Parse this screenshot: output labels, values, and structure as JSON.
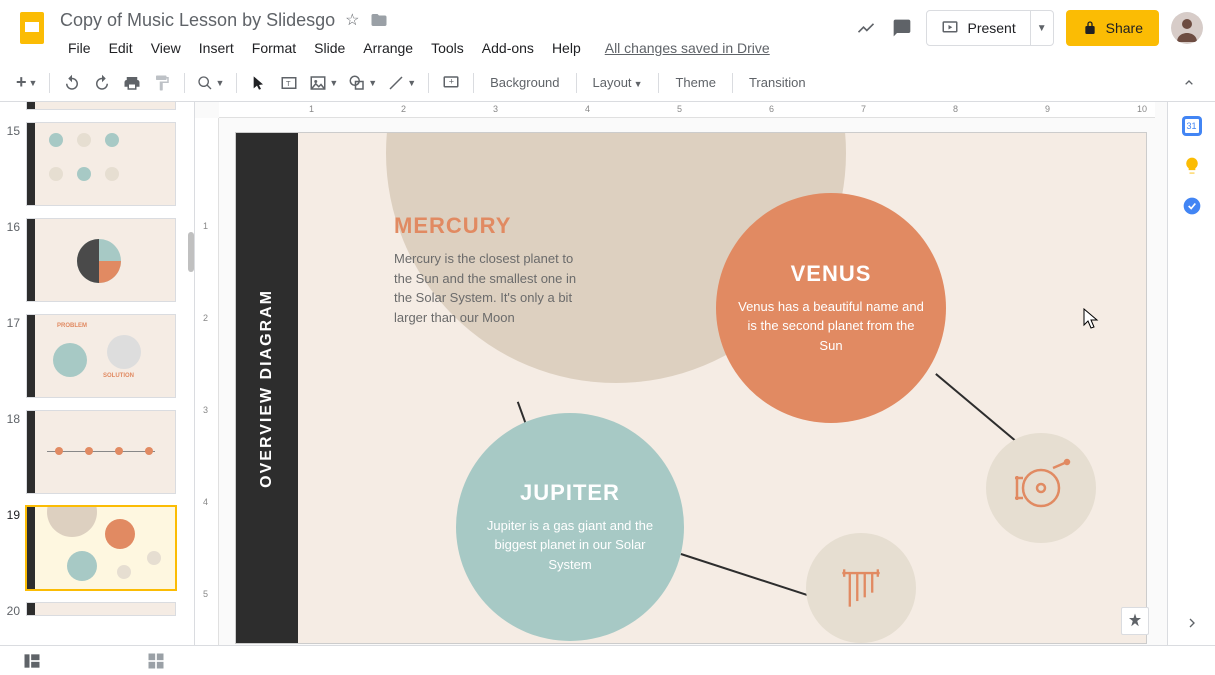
{
  "header": {
    "title": "Copy of Music Lesson by Slidesgo",
    "save_status": "All changes saved in Drive",
    "present_label": "Present",
    "share_label": "Share"
  },
  "menu": {
    "items": [
      "File",
      "Edit",
      "View",
      "Insert",
      "Format",
      "Slide",
      "Arrange",
      "Tools",
      "Add-ons",
      "Help"
    ]
  },
  "toolbar": {
    "background": "Background",
    "layout": "Layout",
    "theme": "Theme",
    "transition": "Transition"
  },
  "filmstrip": {
    "visible": [
      {
        "num": "15"
      },
      {
        "num": "16"
      },
      {
        "num": "17"
      },
      {
        "num": "18"
      },
      {
        "num": "19",
        "selected": true
      },
      {
        "num": "20"
      }
    ]
  },
  "slide": {
    "sidebar_title": "OVERVIEW DIAGRAM",
    "mercury": {
      "title": "MERCURY",
      "body": "Mercury is the closest planet to the Sun and the smallest one in the Solar System. It's only a bit larger than our Moon"
    },
    "venus": {
      "title": "VENUS",
      "body": "Venus has a beautiful name and is the second planet from the Sun"
    },
    "jupiter": {
      "title": "JUPITER",
      "body": "Jupiter is a gas giant and the biggest planet in our Solar System"
    }
  },
  "ruler_h": [
    "1",
    "2",
    "3",
    "4",
    "5",
    "6",
    "7",
    "8",
    "9",
    "10"
  ],
  "ruler_v": [
    "1",
    "2",
    "3",
    "4",
    "5"
  ]
}
